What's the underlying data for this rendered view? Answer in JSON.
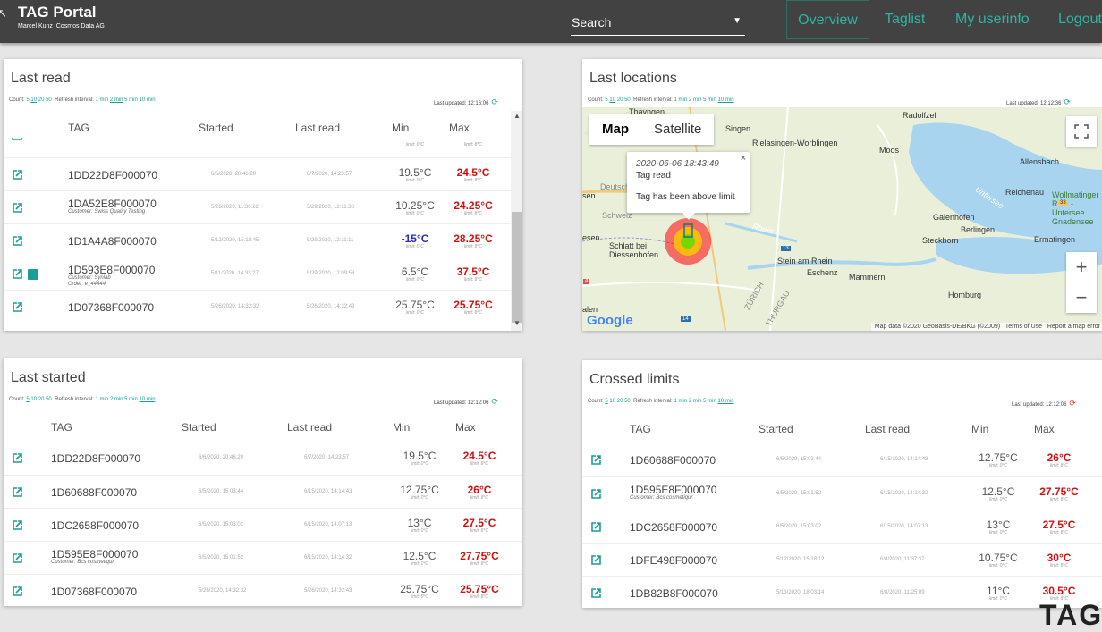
{
  "header": {
    "title": "TAG Portal",
    "user": "Marcel Kunz",
    "org": "Cosmos Data AG",
    "search_label": "Search",
    "nav": [
      "Overview",
      "Taglist",
      "My userinfo",
      "Logout"
    ]
  },
  "colors": {
    "header_bg": "#424242",
    "accent": "#1a9e96",
    "over_limit": "#d11111",
    "under_limit": "#2d2dbd"
  },
  "last_read": {
    "title": "Last read",
    "count_label": "Count:",
    "count_options": [
      "5",
      "10",
      "20",
      "50"
    ],
    "count_selected": "10",
    "refresh_label": "Refresh interval:",
    "refresh_options": [
      "1 min",
      "2 min",
      "5 min",
      "10 min"
    ],
    "refresh_selected": "2 min",
    "updated_label": "Last updated:",
    "updated": "12:16:06",
    "columns": [
      "TAG",
      "Started",
      "Last read",
      "Min",
      "Max"
    ],
    "partial_row": {
      "min_limit": "limit: 0°C",
      "max_limit": "limit: 8°C"
    },
    "rows": [
      {
        "tag": "1DD22D8F000070",
        "sub1": "",
        "sub2": "",
        "started": "6/6/2020, 20:46:20",
        "last": "6/7/2020, 14:23:57",
        "min": "19.5°C",
        "min_style": "plain",
        "min_limit": "limit: 0°C",
        "max": "24.5°C",
        "max_limit": "limit: 8°C",
        "has_image": false
      },
      {
        "tag": "1DA52E8F000070",
        "sub1": "Customer: Swiss Quality Testing",
        "sub2": "",
        "started": "5/26/2020, 11:30:22",
        "last": "5/29/2020, 12:11:38",
        "min": "10.25°C",
        "min_style": "plain",
        "min_limit": "limit: 0°C",
        "max": "24.25°C",
        "max_limit": "limit: 8°C",
        "has_image": false
      },
      {
        "tag": "1D1A4A8F000070",
        "sub1": "",
        "sub2": "",
        "started": "5/12/2020, 15:18:45",
        "last": "5/29/2020, 12:11:11",
        "min": "-15°C",
        "min_style": "blue",
        "min_limit": "limit: 0°C",
        "max": "28.25°C",
        "max_limit": "limit: 8°C",
        "has_image": false
      },
      {
        "tag": "1D593E8F000070",
        "sub1": "Customer: Synlab",
        "sub2": "Order: e_44444",
        "started": "5/11/2020, 14:33:27",
        "last": "5/29/2020, 12:09:58",
        "min": "6.5°C",
        "min_style": "plain",
        "min_limit": "limit: 0°C",
        "max": "37.5°C",
        "max_limit": "limit: 8°C",
        "has_image": true
      },
      {
        "tag": "1D07368F000070",
        "sub1": "",
        "sub2": "",
        "started": "5/26/2020, 14:32:32",
        "last": "5/26/2020, 14:32:43",
        "min": "25.75°C",
        "min_style": "plain",
        "min_limit": "limit: 0°C",
        "max": "25.75°C",
        "max_limit": "limit: 8°C",
        "has_image": false
      }
    ]
  },
  "last_locations": {
    "title": "Last locations",
    "count_label": "Count:",
    "count_options": [
      "5",
      "10",
      "20",
      "50"
    ],
    "count_selected": "10",
    "refresh_label": "Refresh interval:",
    "refresh_options": [
      "1 min",
      "2 min",
      "5 min",
      "10 min"
    ],
    "refresh_selected": "10 min",
    "updated_label": "Last updated:",
    "updated": "12:12:36",
    "map": {
      "type_map": "Map",
      "type_satellite": "Satellite",
      "zoom_in": "+",
      "zoom_out": "−",
      "google": "Google",
      "attrib_data": "Map data ©2020 GeoBasis-DE/BKG (©2009)",
      "attrib_terms": "Terms of Use",
      "attrib_report": "Report a map error",
      "info_date": "2020-06-06 18:43:49",
      "info_name": "Tag read",
      "info_msg": "Tag has been above limit",
      "info_close": "×",
      "places": [
        "Thayngen",
        "Radolfzell",
        "Singen",
        "Rielasingen-Worblingen",
        "Moos",
        "Allensbach",
        "Reichenau",
        "Wollmatinger Ried - Untersee Gnadensee",
        "Gaienhofen",
        "Berlingen",
        "Steckborn",
        "Ermatingen",
        "Schlatt bei Diessenhofen",
        "Stein am Rhein",
        "Eschenz",
        "Mammern",
        "Homburg",
        "Wä",
        "Rhein",
        "Untersee",
        "Deutschland",
        "Schweiz",
        "ZÜRICH",
        "THURGAU",
        "13",
        "14",
        "33",
        "4",
        "alen",
        "esen",
        "sen"
      ]
    }
  },
  "last_started": {
    "title": "Last started",
    "count_label": "Count:",
    "count_options": [
      "5",
      "10",
      "20",
      "50"
    ],
    "count_selected": "5",
    "refresh_label": "Refresh interval:",
    "refresh_options": [
      "1 min",
      "2 min",
      "5 min",
      "10 min"
    ],
    "refresh_selected": "10 min",
    "updated_label": "Last updated:",
    "updated": "12:12:06",
    "columns": [
      "TAG",
      "Started",
      "Last read",
      "Min",
      "Max"
    ],
    "rows": [
      {
        "tag": "1DD22D8F000070",
        "sub1": "",
        "started": "6/6/2020, 20:46:20",
        "last": "6/7/2020, 14:23:57",
        "min": "19.5°C",
        "min_limit": "limit: 0°C",
        "max": "24.5°C",
        "max_limit": "limit: 8°C"
      },
      {
        "tag": "1D60688F000070",
        "sub1": "",
        "started": "6/5/2020, 15:03:44",
        "last": "6/15/2020, 14:14:43",
        "min": "12.75°C",
        "min_limit": "limit: 0°C",
        "max": "26°C",
        "max_limit": "limit: 8°C"
      },
      {
        "tag": "1DC2658F000070",
        "sub1": "",
        "started": "6/5/2020, 15:03:02",
        "last": "6/15/2020, 14:07:13",
        "min": "13°C",
        "min_limit": "limit: 0°C",
        "max": "27.5°C",
        "max_limit": "limit: 8°C"
      },
      {
        "tag": "1D595E8F000070",
        "sub1": "Customer: Bcs cosmetiqur",
        "started": "6/5/2020, 15:01:52",
        "last": "6/15/2020, 14:14:32",
        "min": "12.5°C",
        "min_limit": "limit: 0°C",
        "max": "27.75°C",
        "max_limit": "limit: 8°C"
      },
      {
        "tag": "1D07368F000070",
        "sub1": "",
        "started": "5/26/2020, 14:32:32",
        "last": "5/26/2020, 14:32:43",
        "min": "25.75°C",
        "min_limit": "limit: 0°C",
        "max": "25.75°C",
        "max_limit": "limit: 8°C"
      }
    ]
  },
  "crossed_limits": {
    "title": "Crossed limits",
    "count_label": "Count:",
    "count_options": [
      "5",
      "10",
      "20",
      "50"
    ],
    "count_selected": "5",
    "refresh_label": "Refresh interval:",
    "refresh_options": [
      "1 min",
      "2 min",
      "5 min",
      "10 min"
    ],
    "refresh_selected": "10 min",
    "updated_label": "Last updated:",
    "updated": "12:12:06",
    "columns": [
      "TAG",
      "Started",
      "Last read",
      "Min",
      "Max"
    ],
    "rows": [
      {
        "tag": "1D60688F000070",
        "sub1": "",
        "started": "6/5/2020, 15:03:44",
        "last": "6/15/2020, 14:14:43",
        "min": "12.75°C",
        "min_limit": "limit: 0°C",
        "max": "26°C",
        "max_limit": "limit: 8°C"
      },
      {
        "tag": "1D595E8F000070",
        "sub1": "Customer: Bcs cosmetiqur",
        "started": "6/5/2020, 15:01:52",
        "last": "6/15/2020, 14:14:32",
        "min": "12.5°C",
        "min_limit": "limit: 0°C",
        "max": "27.75°C",
        "max_limit": "limit: 8°C"
      },
      {
        "tag": "1DC2658F000070",
        "sub1": "",
        "started": "6/5/2020, 15:03:02",
        "last": "6/15/2020, 14:07:13",
        "min": "13°C",
        "min_limit": "limit: 0°C",
        "max": "27.5°C",
        "max_limit": "limit: 8°C"
      },
      {
        "tag": "1DFE498F000070",
        "sub1": "",
        "started": "5/12/2020, 15:18:12",
        "last": "6/8/2020, 11:37:37",
        "min": "10.75°C",
        "min_limit": "limit: 0°C",
        "max": "30°C",
        "max_limit": "limit: 8°C"
      },
      {
        "tag": "1DB82B8F000070",
        "sub1": "",
        "started": "5/13/2020, 18:03:14",
        "last": "6/8/2020, 11:25:09",
        "min": "11°C",
        "min_limit": "limit: 0°C",
        "max": "30.5°C",
        "max_limit": "limit: 8°C"
      }
    ]
  },
  "corner_logo": "TAG"
}
